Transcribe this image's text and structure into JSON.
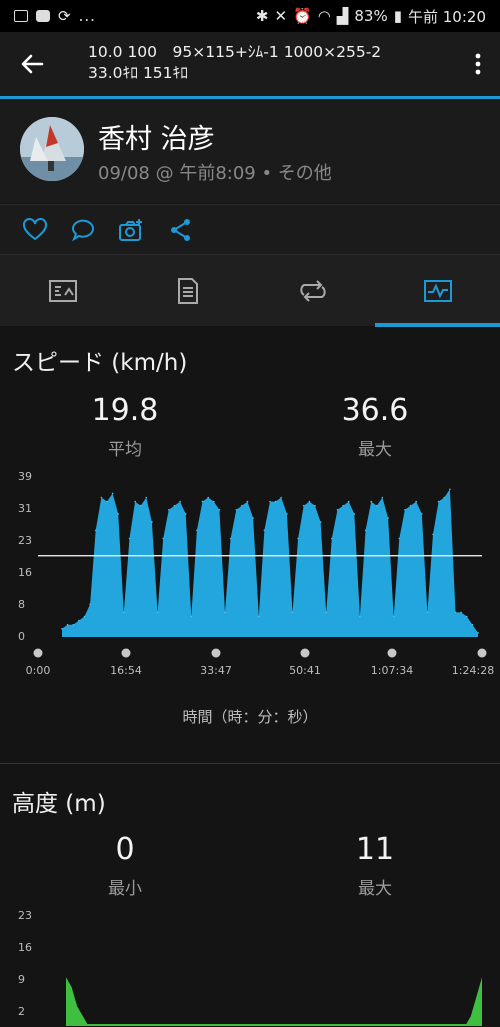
{
  "status": {
    "battery": "83%",
    "time": "午前 10:20",
    "ellipsis": "..."
  },
  "header": {
    "title_line1": "10.0 100　95×115+ｼﾑ-1 1000×255-2",
    "title_line2": "33.0ｷﾛ 151ｷﾛ"
  },
  "profile": {
    "name": "香村 治彦",
    "meta": "09/08 @ 午前8:09 • その他"
  },
  "tabs": [
    "summary-tab",
    "details-tab",
    "laps-tab",
    "charts-tab"
  ],
  "colors": {
    "accent": "#1c9ad6",
    "speed_fill": "#22a6dd",
    "elev_fill": "#3fbf3f"
  },
  "speed": {
    "title": "スピード (km/h)",
    "avg_value": "19.8",
    "avg_label": "平均",
    "max_value": "36.6",
    "max_label": "最大",
    "xaxis_label": "時間（時：分：秒）"
  },
  "elevation": {
    "title": "高度 (m)",
    "min_value": "0",
    "min_label": "最小",
    "max_value": "11",
    "max_label": "最大"
  },
  "chart_data": [
    {
      "type": "area",
      "title": "スピード (km/h)",
      "xlabel": "時間（時：分：秒）",
      "ylabel": "",
      "ylim": [
        0,
        39
      ],
      "yticks": [
        "0",
        "8",
        "16",
        "23",
        "31",
        "39"
      ],
      "xticks": [
        "0:00",
        "16:54",
        "33:47",
        "50:41",
        "1:07:34",
        "1:24:28"
      ],
      "average_line": 19.8,
      "series": [
        {
          "values": [
            2,
            3,
            3,
            4,
            5,
            8,
            26,
            34,
            33,
            35,
            30,
            6,
            24,
            33,
            32,
            34,
            28,
            6,
            24,
            31,
            32,
            33,
            30,
            5,
            26,
            33,
            34,
            33,
            31,
            6,
            24,
            31,
            32,
            33,
            29,
            5,
            26,
            33,
            33,
            34,
            30,
            6,
            24,
            32,
            33,
            32,
            28,
            6,
            24,
            31,
            32,
            33,
            30,
            5,
            26,
            33,
            32,
            34,
            29,
            5,
            24,
            31,
            32,
            33,
            30,
            6,
            25,
            33,
            34,
            36,
            6,
            6,
            5,
            3,
            1
          ]
        }
      ]
    },
    {
      "type": "area",
      "title": "高度 (m)",
      "ylim": [
        0,
        23
      ],
      "yticks": [
        "2",
        "9",
        "16",
        "23"
      ],
      "series": [
        {
          "values": [
            10,
            8,
            4,
            2,
            0,
            0,
            0,
            0,
            0,
            0,
            0,
            0,
            0,
            0,
            0,
            0,
            0,
            0,
            0,
            0,
            0,
            0,
            0,
            0,
            0,
            0,
            0,
            0,
            0,
            0,
            0,
            0,
            0,
            0,
            0,
            0,
            0,
            0,
            0,
            0,
            0,
            0,
            0,
            0,
            0,
            0,
            0,
            0,
            0,
            0,
            0,
            0,
            0,
            0,
            0,
            0,
            0,
            0,
            0,
            0,
            0,
            0,
            0,
            0,
            0,
            0,
            0,
            0,
            0,
            0,
            0,
            0,
            2,
            6,
            10
          ]
        }
      ]
    }
  ]
}
